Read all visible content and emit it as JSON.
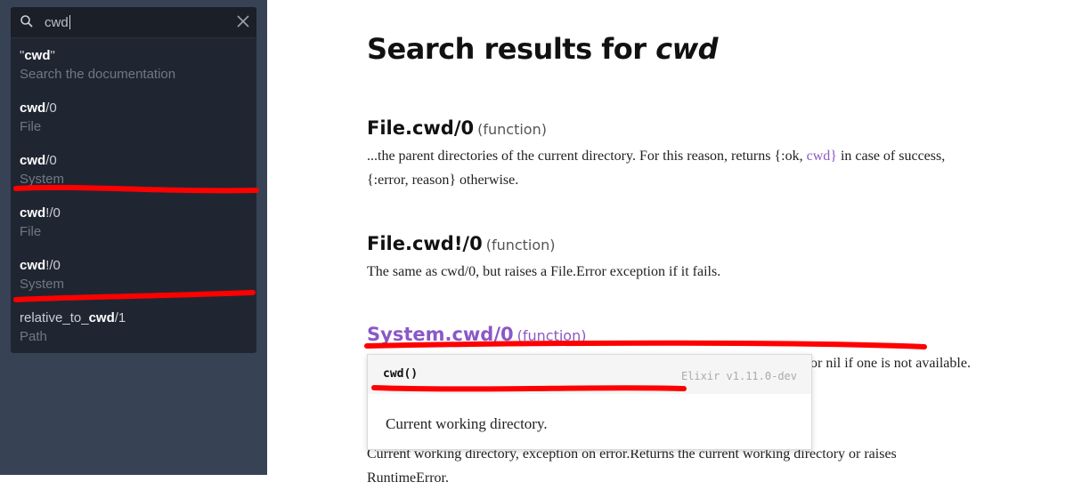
{
  "search": {
    "query": "cwd",
    "suggestions": [
      {
        "prefix": "\"",
        "match": "cwd",
        "suffix": "\"",
        "sub": "Search the documentation"
      },
      {
        "prefix": "",
        "match": "cwd",
        "suffix": "/0",
        "sub": "File"
      },
      {
        "prefix": "",
        "match": "cwd",
        "suffix": "/0",
        "sub": "System"
      },
      {
        "prefix": "",
        "match": "cwd",
        "suffix": "!/0",
        "sub": "File"
      },
      {
        "prefix": "",
        "match": "cwd",
        "suffix": "!/0",
        "sub": "System"
      },
      {
        "prefix": "relative_to_",
        "match": "cwd",
        "suffix": "/1",
        "sub": "Path"
      }
    ]
  },
  "page": {
    "title_prefix": "Search results for",
    "title_query": "cwd"
  },
  "results": [
    {
      "name": "File.cwd/0",
      "kind": "(function)",
      "text1": "...the parent directories of the current directory. For this reason, returns {:ok,",
      "link": "cwd}",
      "text2": "in case of success,",
      "text3": "{:error, reason} otherwise."
    },
    {
      "name": "File.cwd!/0",
      "kind": "(function)",
      "text1": "The same as cwd/0, but raises a File.Error exception if it fails."
    },
    {
      "name": "System.cwd/0",
      "kind": "(function)",
      "text1": "y or nil if one is not available."
    },
    {
      "text1": "Current working directory, exception on error.Returns the current working directory or raises",
      "text2": "RuntimeError."
    }
  ],
  "popup": {
    "signature": "cwd()",
    "version": "Elixir v1.11.0-dev",
    "description": "Current working directory."
  },
  "colors": {
    "sidebar_bg": "#374254",
    "panel_bg": "#202631",
    "link": "#8b58c6",
    "annotation_red": "#ff0000"
  }
}
